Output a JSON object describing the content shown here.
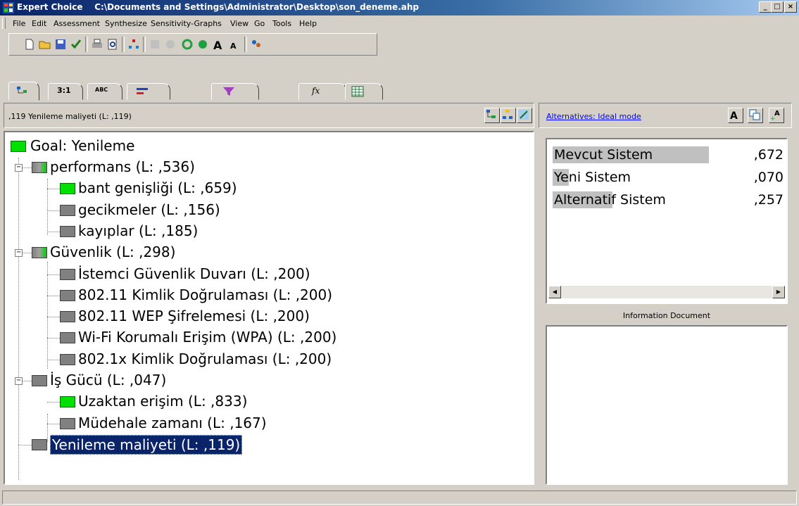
{
  "window": {
    "app_name": "Expert Choice",
    "file_path": "C:\\Documents and Settings\\Administrator\\Desktop\\son_deneme.ahp",
    "minimize": "_",
    "maximize": "□",
    "close": "×"
  },
  "menu": [
    "File",
    "Edit",
    "Assessment",
    "Synthesize",
    "Sensitivity-Graphs",
    "View",
    "Go",
    "Tools",
    "Help"
  ],
  "tabs": [
    {
      "icon": "tree-view-icon"
    },
    {
      "label": "3:1"
    },
    {
      "label": "ABC"
    },
    {
      "icon": "bar-chart-icon"
    },
    {
      "icon": "data-icon"
    },
    {
      "icon": "formula-icon",
      "label": "fx"
    },
    {
      "icon": "grid-icon"
    }
  ],
  "breadcrumb": ",119 Yenileme maliyeti (L: ,119)",
  "tree": {
    "goal": "Goal: Yenileme",
    "nodes": [
      {
        "label": "performans (L: ,536)",
        "level": 1,
        "color": "grad"
      },
      {
        "label": "bant genişliği (L: ,659)",
        "level": 2,
        "color": "green"
      },
      {
        "label": "gecikmeler (L: ,156)",
        "level": 2,
        "color": "gray"
      },
      {
        "label": "kayıplar (L: ,185)",
        "level": 2,
        "color": "gray"
      },
      {
        "label": "Güvenlik (L: ,298)",
        "level": 1,
        "color": "grad"
      },
      {
        "label": "İstemci Güvenlik Duvarı (L: ,200)",
        "level": 2,
        "color": "gray"
      },
      {
        "label": "802.11 Kimlik Doğrulaması (L: ,200)",
        "level": 2,
        "color": "gray"
      },
      {
        "label": "802.11 WEP Şifrelemesi (L: ,200)",
        "level": 2,
        "color": "gray"
      },
      {
        "label": "Wi-Fi Korumalı Erişim (WPA) (L: ,200)",
        "level": 2,
        "color": "gray"
      },
      {
        "label": "802.1x Kimlik Doğrulaması (L: ,200)",
        "level": 2,
        "color": "gray"
      },
      {
        "label": "İş Gücü (L: ,047)",
        "level": 1,
        "color": "gray"
      },
      {
        "label": "Uzaktan erişim (L: ,833)",
        "level": 2,
        "color": "green"
      },
      {
        "label": "Müdehale zamanı (L: ,167)",
        "level": 2,
        "color": "gray"
      },
      {
        "label": "Yenileme maliyeti (L: ,119)",
        "level": 1,
        "color": "gray",
        "selected": true
      }
    ]
  },
  "alternatives": {
    "header_link": "Alternatives: Ideal mode",
    "items": [
      {
        "name": "Mevcut Sistem",
        "value": ",672",
        "priority": 1.0
      },
      {
        "name": "Yeni Sistem",
        "value": ",070",
        "priority": 0.104
      },
      {
        "name": "Alternatif Sistem",
        "value": ",257",
        "priority": 0.382
      }
    ]
  },
  "info_label": "Information Document"
}
